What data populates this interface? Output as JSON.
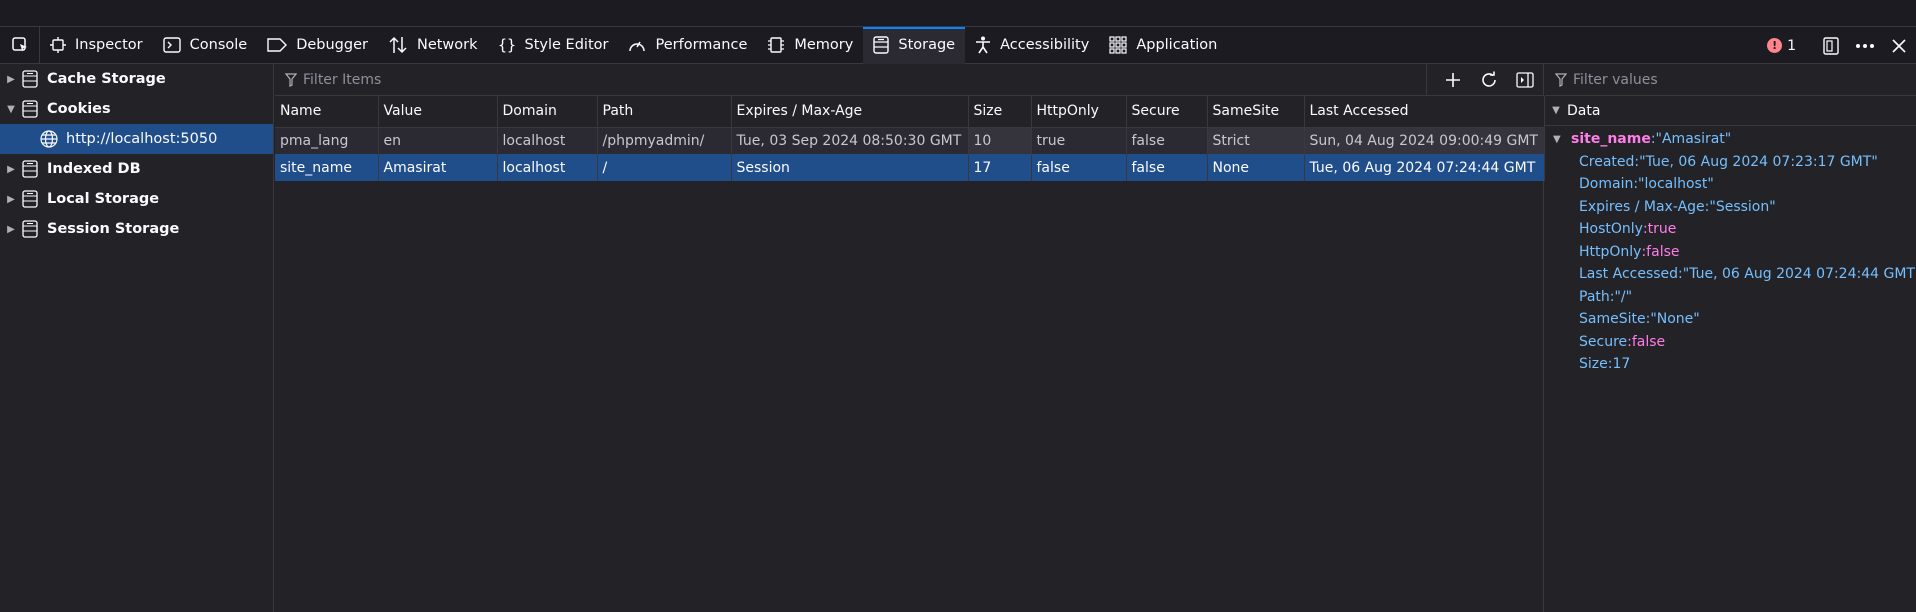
{
  "toolbar": {
    "tabs": [
      {
        "label": "Inspector",
        "icon": "inspector-icon"
      },
      {
        "label": "Console",
        "icon": "console-icon"
      },
      {
        "label": "Debugger",
        "icon": "debugger-icon"
      },
      {
        "label": "Network",
        "icon": "network-icon"
      },
      {
        "label": "Style Editor",
        "icon": "style-editor-icon"
      },
      {
        "label": "Performance",
        "icon": "performance-icon"
      },
      {
        "label": "Memory",
        "icon": "memory-icon"
      },
      {
        "label": "Storage",
        "icon": "storage-icon",
        "selected": true
      },
      {
        "label": "Accessibility",
        "icon": "accessibility-icon"
      },
      {
        "label": "Application",
        "icon": "application-icon"
      }
    ],
    "error_count": "1"
  },
  "sidebar": {
    "items": [
      {
        "label": "Cache Storage",
        "expanded": false
      },
      {
        "label": "Cookies",
        "expanded": true
      },
      {
        "label": "http://localhost:5050",
        "child": true
      },
      {
        "label": "Indexed DB",
        "expanded": false
      },
      {
        "label": "Local Storage",
        "expanded": false
      },
      {
        "label": "Session Storage",
        "expanded": false
      }
    ]
  },
  "main": {
    "filter_placeholder": "Filter Items",
    "columns": [
      "Name",
      "Value",
      "Domain",
      "Path",
      "Expires / Max-Age",
      "Size",
      "HttpOnly",
      "Secure",
      "SameSite",
      "Last Accessed"
    ],
    "rows": [
      [
        "pma_lang",
        "en",
        "localhost",
        "/phpmyadmin/",
        "Tue, 03 Sep 2024 08:50:30 GMT",
        "10",
        "true",
        "false",
        "Strict",
        "Sun, 04 Aug 2024 09:00:49 GMT"
      ],
      [
        "site_name",
        "Amasirat",
        "localhost",
        "/",
        "Session",
        "17",
        "false",
        "false",
        "None",
        "Tue, 06 Aug 2024 07:24:44 GMT"
      ]
    ]
  },
  "sidepanel": {
    "filter_placeholder": "Filter values",
    "section_label": "Data",
    "root_key": "site_name",
    "root_value": ":\"Amasirat\"",
    "props": [
      {
        "key": "Created",
        "value": ":\"Tue, 06 Aug 2024 07:23:17 GMT\"",
        "kind": "s"
      },
      {
        "key": "Domain",
        "value": ":\"localhost\"",
        "kind": "s"
      },
      {
        "key": "Expires / Max-Age",
        "value": ":\"Session\"",
        "kind": "s"
      },
      {
        "key": "HostOnly",
        "value": ":true",
        "kind": "b"
      },
      {
        "key": "HttpOnly",
        "value": ":false",
        "kind": "b"
      },
      {
        "key": "Last Accessed",
        "value": ":\"Tue, 06 Aug 2024 07:24:44 GMT\"",
        "kind": "s"
      },
      {
        "key": "Path",
        "value": ":\"/\"",
        "kind": "s"
      },
      {
        "key": "SameSite",
        "value": ":\"None\"",
        "kind": "s"
      },
      {
        "key": "Secure",
        "value": ":false",
        "kind": "b"
      },
      {
        "key": "Size",
        "value": ":17",
        "kind": "n"
      }
    ]
  },
  "colors": {
    "accent": "#0a84ff",
    "selection": "#204e8a",
    "error": "#ff848b"
  }
}
